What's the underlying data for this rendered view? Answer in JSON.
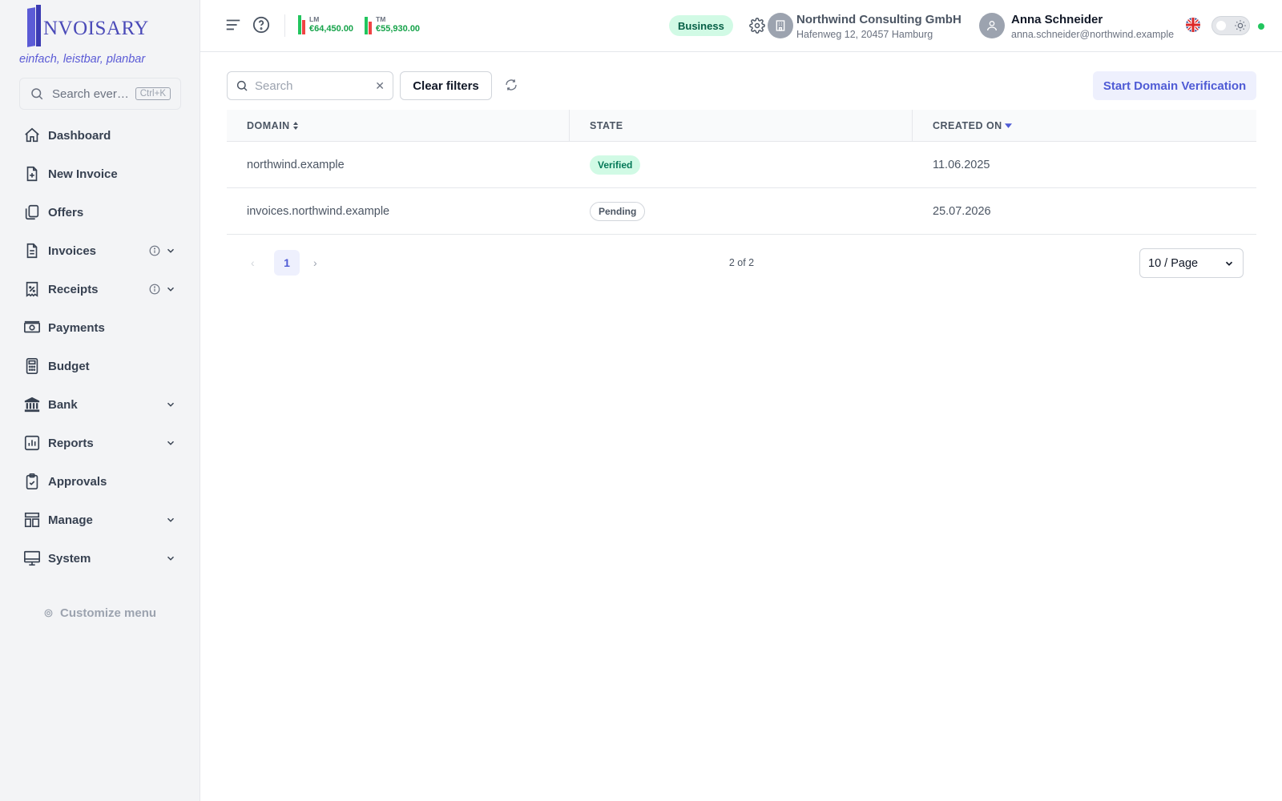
{
  "brand": {
    "logo_text": "NVOISARY",
    "tagline": "einfach, leistbar, planbar",
    "accent_color": "#4f5bd5"
  },
  "sidebar": {
    "search_placeholder": "Search ever…",
    "search_shortcut": "Ctrl+K",
    "items": [
      {
        "label": "Dashboard",
        "icon": "home-icon"
      },
      {
        "label": "New Invoice",
        "icon": "file-plus-icon"
      },
      {
        "label": "Offers",
        "icon": "copy-icon"
      },
      {
        "label": "Invoices",
        "icon": "file-text-icon"
      },
      {
        "label": "Receipts",
        "icon": "receipt-icon"
      },
      {
        "label": "Payments",
        "icon": "banknote-icon"
      },
      {
        "label": "Budget",
        "icon": "calculator-icon"
      },
      {
        "label": "Bank",
        "icon": "bank-icon"
      },
      {
        "label": "Reports",
        "icon": "bar-chart-icon"
      },
      {
        "label": "Approvals",
        "icon": "clipboard-check-icon"
      },
      {
        "label": "Manage",
        "icon": "layout-icon"
      },
      {
        "label": "System",
        "icon": "monitor-icon"
      }
    ],
    "customize_label": "Customize menu"
  },
  "header": {
    "kpis": [
      {
        "label": "LM",
        "value": "€64,450.00"
      },
      {
        "label": "TM",
        "value": "€55,930.00"
      }
    ],
    "plan_badge": "Business",
    "company": {
      "name": "Northwind Consulting GmbH",
      "address": "Hafenweg 12, 20457 Hamburg"
    },
    "user": {
      "name": "Anna Schneider",
      "email": "anna.schneider@northwind.example"
    },
    "status_color": "#22c55e"
  },
  "toolbar": {
    "search_placeholder": "Search",
    "clear_filters_label": "Clear filters",
    "primary_action_label": "Start Domain Verification"
  },
  "table": {
    "columns": [
      "DOMAIN",
      "STATE",
      "CREATED ON"
    ],
    "rows": [
      {
        "domain": "northwind.example",
        "state": "Verified",
        "created_on": "11.06.2025"
      },
      {
        "domain": "invoices.northwind.example",
        "state": "Pending",
        "created_on": "25.07.2026"
      }
    ]
  },
  "pagination": {
    "current_page": "1",
    "count_text": "2 of 2",
    "page_size": "10 / Page"
  }
}
